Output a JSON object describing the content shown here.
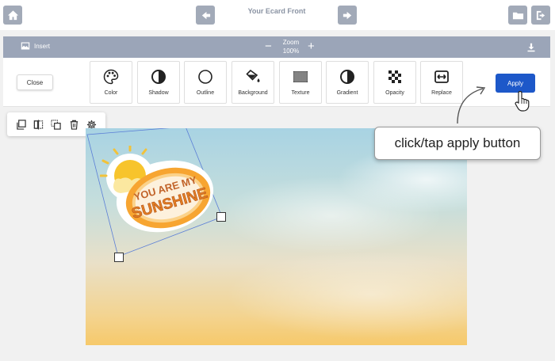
{
  "header": {
    "title": "Your Ecard Front",
    "icons": [
      "home-icon",
      "arrow-left-icon",
      "arrow-right-icon",
      "folder-icon",
      "exit-icon"
    ]
  },
  "toolbar": {
    "insert_label": "Insert",
    "zoom_label": "Zoom",
    "zoom_value": "100%",
    "zoom_minus": "−",
    "zoom_plus": "+"
  },
  "effects": {
    "close_label": "Close",
    "tools": [
      {
        "label": "Color",
        "icon": "palette-icon"
      },
      {
        "label": "Shadow",
        "icon": "half-circle-icon"
      },
      {
        "label": "Outline",
        "icon": "circle-outline-icon"
      },
      {
        "label": "Background",
        "icon": "paint-bucket-icon"
      },
      {
        "label": "Texture",
        "icon": "texture-icon"
      },
      {
        "label": "Gradient",
        "icon": "gradient-icon"
      },
      {
        "label": "Opacity",
        "icon": "checker-icon"
      },
      {
        "label": "Replace",
        "icon": "replace-icon"
      }
    ],
    "apply_label": "Apply"
  },
  "object_tools": [
    "copy-icon",
    "flip-icon",
    "layer-icon",
    "trash-icon",
    "gear-icon"
  ],
  "sticker": {
    "line1": "YOU ARE MY",
    "line2": "SUNSHINE"
  },
  "hint": {
    "text": "click/tap apply button"
  },
  "colors": {
    "accent": "#1d58c9",
    "toolbar": "#9ba5b8",
    "header_button": "#a2aab8",
    "sticker_orange": "#f0a02a"
  }
}
